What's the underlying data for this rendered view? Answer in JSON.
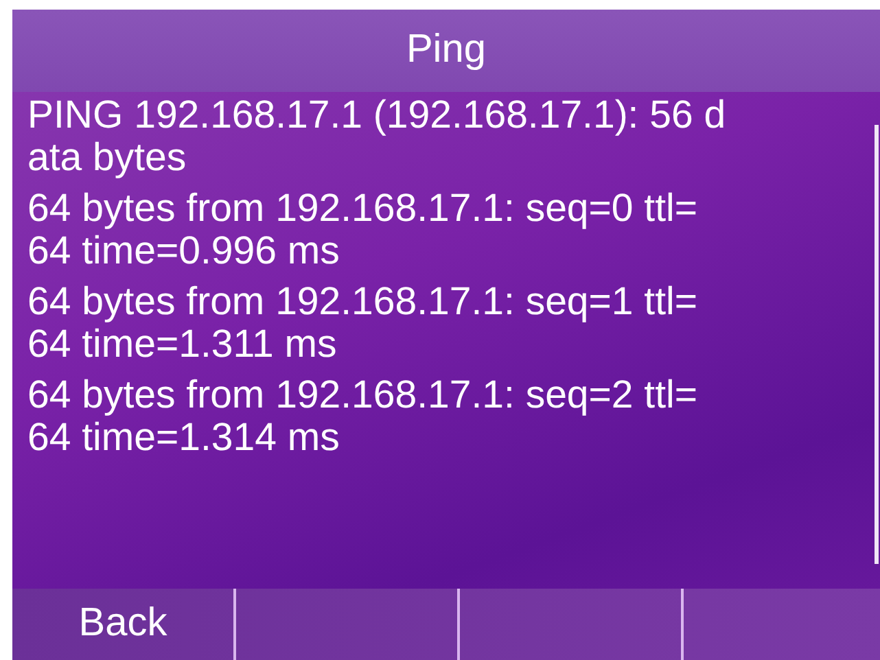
{
  "title": "Ping",
  "output": [
    {
      "lines": [
        "PING 192.168.17.1 (192.168.17.1): 56 d",
        "ata bytes"
      ]
    },
    {
      "lines": [
        "64 bytes from 192.168.17.1: seq=0 ttl=",
        "64 time=0.996 ms"
      ]
    },
    {
      "lines": [
        "64 bytes from 192.168.17.1: seq=1 ttl=",
        "64 time=1.311 ms"
      ]
    },
    {
      "lines": [
        "64 bytes from 192.168.17.1: seq=2 ttl=",
        "64 time=1.314 ms"
      ]
    }
  ],
  "softkeys": [
    {
      "label": "Back"
    }
  ]
}
